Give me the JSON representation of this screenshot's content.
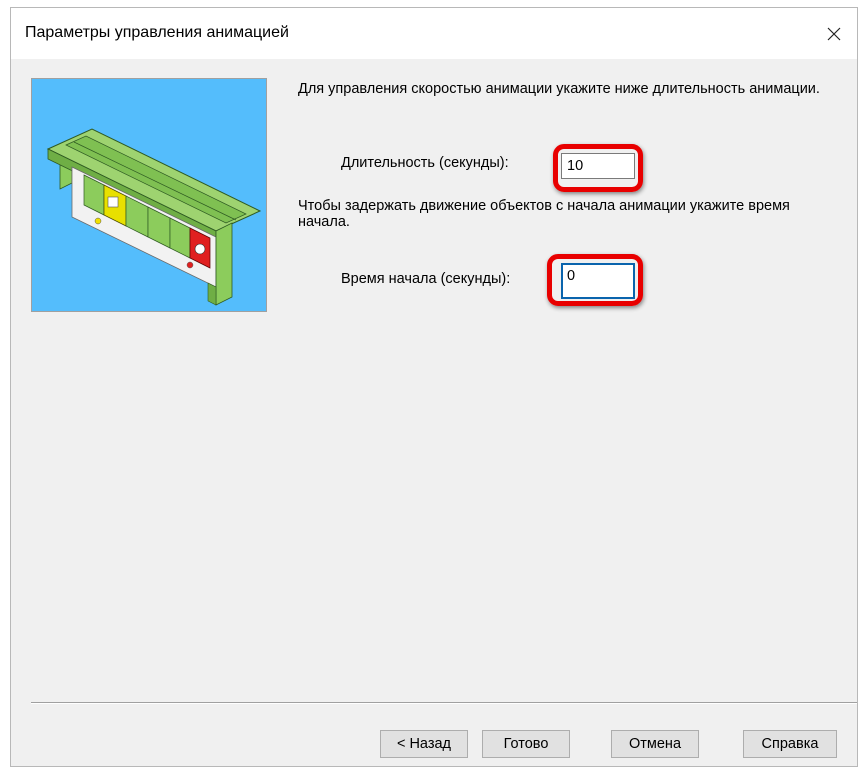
{
  "dialog": {
    "title": "Параметры управления анимацией",
    "close_icon": "close-icon"
  },
  "preview": {
    "icon": "assembly-preview-image",
    "background": "#54bdfc"
  },
  "content": {
    "intro": "Для управления скоростью анимации укажите ниже длительность анимации.",
    "duration_label": "Длительность (секунды):",
    "duration_value": "10",
    "delay_text": "Чтобы задержать движение объектов с начала анимации укажите время начала.",
    "start_label": "Время начала (секунды):",
    "start_value": "0"
  },
  "buttons": {
    "back": "< Назад",
    "finish": "Готово",
    "cancel": "Отмена",
    "help": "Справка"
  },
  "colors": {
    "highlight": "#e80000",
    "focus": "#0a64ad"
  }
}
